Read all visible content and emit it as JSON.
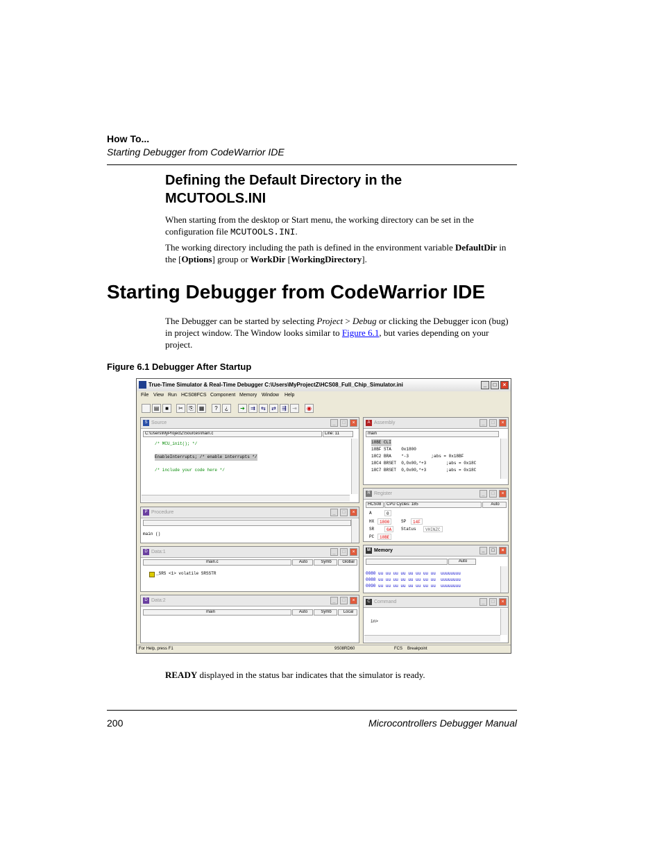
{
  "header": {
    "section": "How To...",
    "subtitle": "Starting Debugger from CodeWarrior IDE"
  },
  "section1": {
    "title": "Defining the Default Directory in the MCUTOOLS.INI",
    "p1_a": "When starting from the desktop or Start menu, the working directory can be set in the configuration file ",
    "p1_code": "MCUTOOLS.INI",
    "p1_b": ".",
    "p2_a": "The working directory including the path is defined in the environment variable ",
    "p2_b1": "DefaultDir",
    "p2_c": " in the [",
    "p2_b2": "Options",
    "p2_d": "] group or ",
    "p2_b3": "WorkDir",
    "p2_e": " [",
    "p2_b4": "WorkingDirectory",
    "p2_f": "]."
  },
  "section2": {
    "title": "Starting Debugger from CodeWarrior IDE",
    "p_a": "The Debugger can be started by selecting ",
    "p_i1": "Project",
    "p_b": " > ",
    "p_i2": "Debug",
    "p_c": " or clicking the Debugger icon (bug) in project window. The Window looks similar to ",
    "p_link": "Figure 6.1",
    "p_d": ", but varies depending on your project."
  },
  "figure": {
    "caption": "Figure 6.1  Debugger After Startup"
  },
  "screenshot": {
    "title": "True-Time Simulator & Real-Time Debugger   C:\\Users\\MyProjectZ\\HCS08_Full_Chip_Simulator.ini",
    "menu": [
      "File",
      "View",
      "Run",
      "HCS08FCS",
      "Component",
      "Memory",
      "Window",
      "Help"
    ],
    "source": {
      "title": "Source",
      "path": "C:\\Users\\MyProjectZ\\Sources\\main.c",
      "line": "Line: 11",
      "code1": "/* MCU_init(); */",
      "code2": "EnableInterrupts; /* enable interrupts */",
      "code3": "/* include your code here */"
    },
    "assembly": {
      "title": "Assembly",
      "func": "main",
      "lines": [
        "18BE CLI",
        "18BF STA    0x1800",
        "18C2 BRA    *-3         ;abs = 0x18BF",
        "18C4 BRSET  0,0x00,*+3        ;abs = 0x18C",
        "18C7 BRSET  0,0x00,*+3        ;abs = 0x18C"
      ]
    },
    "procedure": {
      "title": "Procedure",
      "entry": "main ()"
    },
    "register": {
      "title": "Register",
      "cpu": "HCS08",
      "cycles": "CPU Cycles: 185",
      "auto": "Auto",
      "a_label": "A",
      "a_val": "0",
      "hx_label": "HX",
      "hx_val": "1800",
      "sp_label": "SP",
      "sp_val": "14F",
      "sr_label": "SR",
      "sr_val": "6A",
      "status_label": "Status",
      "status_val": "VHINZC",
      "pc_label": "PC",
      "pc_val": "18BE"
    },
    "data1": {
      "title": "Data:1",
      "module": "main.c",
      "auto": "Auto",
      "symb": "Symb",
      "scope": "Global",
      "entry": "_SRS <1> volatile SRSSTR"
    },
    "memory": {
      "title": "Memory",
      "auto": "Auto",
      "rows": [
        "0080 uu uu uu uu uu uu uu uu  uuuuuuuu",
        "0088 uu uu uu uu uu uu uu uu  uuuuuuuu",
        "0090 uu uu uu uu uu uu uu uu  uuuuuuuu"
      ]
    },
    "data2": {
      "title": "Data:2",
      "module": "main",
      "auto": "Auto",
      "symb": "Symb",
      "scope": "Local"
    },
    "command": {
      "title": "Command",
      "prompt": "in>"
    },
    "status": {
      "help": "For Help, press F1",
      "device": "9S08RD60",
      "target": "FCS",
      "state": "Breakpoint"
    }
  },
  "after_figure": {
    "b": "READY",
    "text": " displayed in the status bar indicates that the simulator is ready."
  },
  "footer": {
    "page": "200",
    "manual": "Microcontrollers Debugger Manual"
  }
}
